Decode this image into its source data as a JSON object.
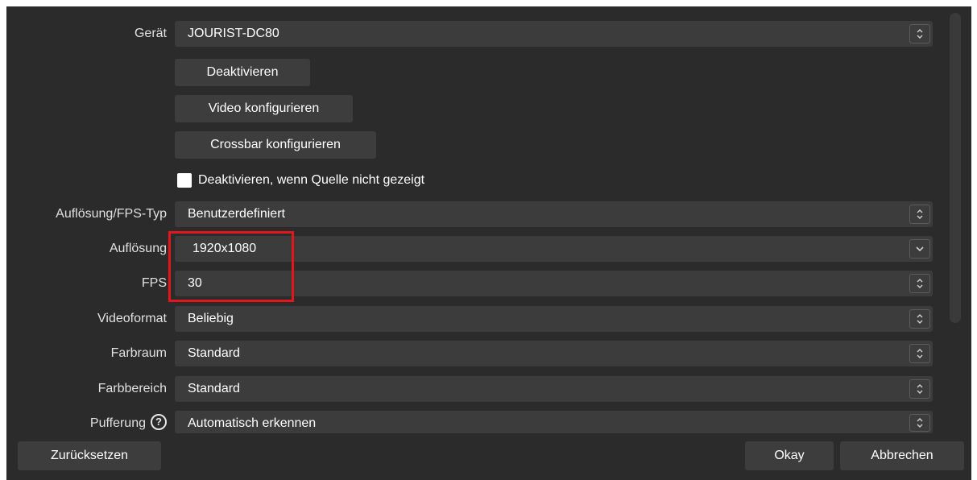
{
  "device": {
    "label": "Gerät",
    "value": "JOURIST-DC80"
  },
  "buttons": {
    "deactivate": "Deaktivieren",
    "configure_video": "Video konfigurieren",
    "configure_crossbar": "Crossbar konfigurieren"
  },
  "checkbox": {
    "label": "Deaktivieren, wenn Quelle nicht gezeigt",
    "checked": false
  },
  "res_fps_type": {
    "label": "Auflösung/FPS-Typ",
    "value": "Benutzerdefiniert"
  },
  "resolution": {
    "label": "Auflösung",
    "value": "1920x1080"
  },
  "fps": {
    "label": "FPS",
    "value": "30"
  },
  "video_format": {
    "label": "Videoformat",
    "value": "Beliebig"
  },
  "color_space": {
    "label": "Farbraum",
    "value": "Standard"
  },
  "color_range": {
    "label": "Farbbereich",
    "value": "Standard"
  },
  "buffering": {
    "label": "Pufferung",
    "value": "Automatisch erkennen",
    "help_glyph": "?"
  },
  "footer": {
    "reset": "Zurücksetzen",
    "ok": "Okay",
    "cancel": "Abbrechen"
  },
  "colors": {
    "background": "#2b2b2b",
    "field": "#3c3c3c",
    "highlight": "#e3161c"
  }
}
